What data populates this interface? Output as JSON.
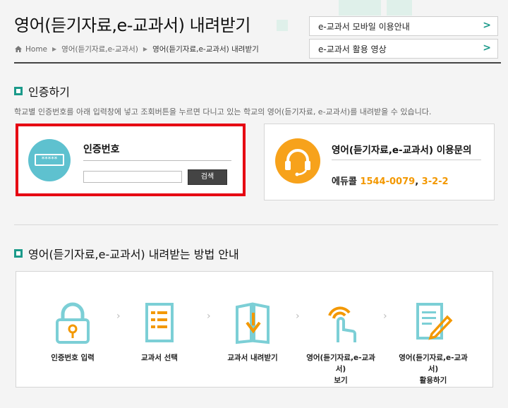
{
  "header": {
    "title": "영어(듣기자료,e-교과서) 내려받기",
    "breadcrumb": [
      "Home",
      "영어(듣기자료,e-교과서)",
      "영어(듣기자료,e-교과서) 내려받기"
    ]
  },
  "quick_links": [
    {
      "label": "e-교과서 모바일 이용안내"
    },
    {
      "label": "e-교과서 활용 영상"
    }
  ],
  "auth_section": {
    "title": "인증하기",
    "description": "학교별 인증번호를 아래 입력창에 넣고 조회버튼을 누르면 다니고 있는 학교의 영어(듣기자료, e-교과서)를 내려받을 수 있습니다.",
    "code_label": "인증번호",
    "password_mask": "*****",
    "input_value": "",
    "search_button": "검색"
  },
  "inquiry": {
    "title": "영어(듣기자료,e-교과서) 이용문의",
    "org": "에듀콜",
    "phone": "1544-0079",
    "comma": ",",
    "ext": "3-2-2"
  },
  "guide_section": {
    "title": "영어(듣기자료,e-교과서) 내려받는 방법 안내",
    "steps": [
      {
        "icon": "lock-icon",
        "label": "인증번호 입력"
      },
      {
        "icon": "document-list-icon",
        "label": "교과서 선택"
      },
      {
        "icon": "download-book-icon",
        "label": "교과서 내려받기"
      },
      {
        "icon": "touch-hand-icon",
        "label": "영어(듣기자료,e-교과서)",
        "label2": "보기"
      },
      {
        "icon": "edit-document-icon",
        "label": "영어(듣기자료,e-교과서)",
        "label2": "활용하기"
      }
    ]
  },
  "colors": {
    "accent": "#1b9a8a",
    "highlight_border": "#e60012",
    "auth_icon_bg": "#5ec1cf",
    "inquiry_icon_bg": "#f7a21b",
    "phone": "#f39800"
  }
}
